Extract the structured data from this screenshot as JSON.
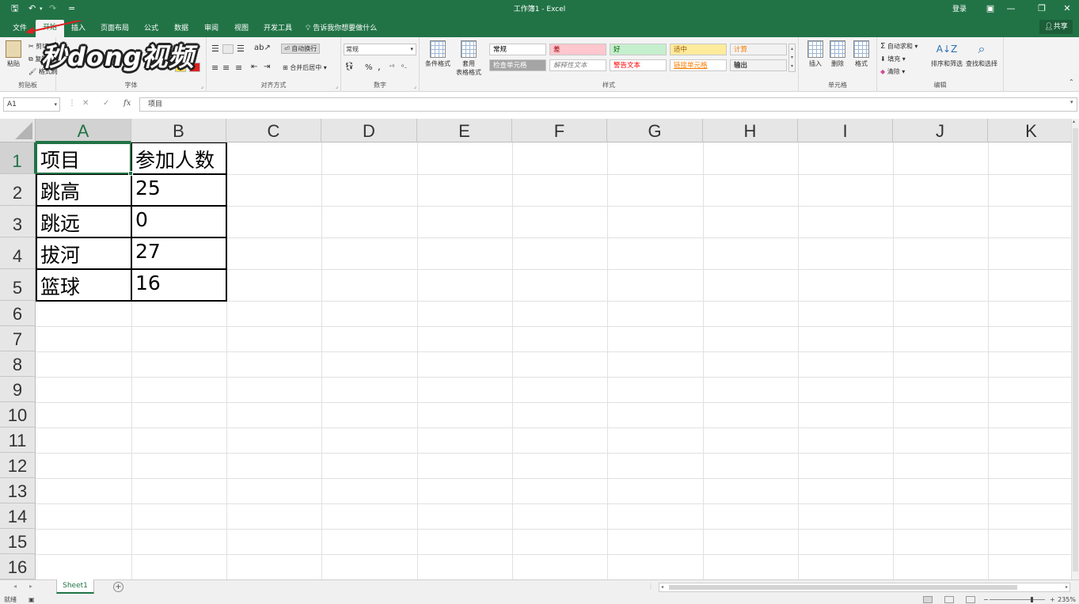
{
  "window": {
    "title": "工作簿1  -  Excel",
    "user": "登录",
    "minimize_glyph": "—",
    "restore_glyph": "❐",
    "close_glyph": "✕",
    "ribbon_toggle_glyph": "▣"
  },
  "quick_access": {
    "save_glyph": "🖫",
    "undo_glyph": "↶",
    "redo_glyph": "↷",
    "customize_glyph": "="
  },
  "tabs": {
    "file": "文件",
    "home": "开始",
    "insert": "插入",
    "page_layout": "页面布局",
    "formulas": "公式",
    "data": "数据",
    "review": "审阅",
    "view": "视图",
    "developer": "开发工具",
    "tell_me": "告诉我你想要做什么",
    "share": "共享"
  },
  "ribbon": {
    "clipboard": {
      "label": "剪贴板",
      "paste": "粘贴",
      "cut": "剪切",
      "copy": "复制",
      "format_painter": "格式刷"
    },
    "font": {
      "label": "字体"
    },
    "alignment": {
      "label": "对齐方式",
      "wrap_text": "自动换行",
      "merge_center": "合并后居中"
    },
    "number": {
      "label": "数字",
      "format": "常规",
      "percent": "%",
      "comma": ","
    },
    "styles": {
      "label": "样式",
      "conditional": "条件格式",
      "table_line1": "套用",
      "table_line2": "表格格式",
      "cells": [
        {
          "name": "常规",
          "bg": "#ffffff",
          "color": "#000000"
        },
        {
          "name": "差",
          "bg": "#ffc7ce",
          "color": "#9c0006"
        },
        {
          "name": "好",
          "bg": "#c6efce",
          "color": "#006100"
        },
        {
          "name": "适中",
          "bg": "#ffeb9c",
          "color": "#9c5700"
        },
        {
          "name": "计算",
          "bg": "#f2f2f2",
          "color": "#fa7d00"
        },
        {
          "name": "检查单元格",
          "bg": "#a5a5a5",
          "color": "#ffffff"
        },
        {
          "name": "解释性文本",
          "bg": "#ffffff",
          "color": "#7f7f7f"
        },
        {
          "name": "警告文本",
          "bg": "#ffffff",
          "color": "#ff0000"
        },
        {
          "name": "链接单元格",
          "bg": "#ffffff",
          "color": "#fa7d00"
        },
        {
          "name": "输出",
          "bg": "#f2f2f2",
          "color": "#3f3f3f"
        }
      ]
    },
    "cells_group": {
      "label": "单元格",
      "insert": "插入",
      "delete": "删除",
      "format": "格式"
    },
    "editing": {
      "label": "编辑",
      "autosum": "自动求和",
      "fill": "填充",
      "clear": "清除",
      "sort_filter": "排序和筛选",
      "find_select": "查找和选择"
    }
  },
  "watermark": "秒dong视频",
  "formula_bar": {
    "name_box": "A1",
    "content": "项目"
  },
  "grid": {
    "columns": [
      "A",
      "B",
      "C",
      "D",
      "E",
      "F",
      "G",
      "H",
      "I",
      "J",
      "K"
    ],
    "rows": [
      "1",
      "2",
      "3",
      "4",
      "5",
      "6",
      "7",
      "8",
      "9",
      "10",
      "11",
      "12",
      "13",
      "14",
      "15",
      "16"
    ],
    "selected_cell": "A1",
    "data": [
      [
        "项目",
        "参加人数"
      ],
      [
        "跳高",
        "25"
      ],
      [
        "跳远",
        "0"
      ],
      [
        "拔河",
        "27"
      ],
      [
        "篮球",
        "16"
      ]
    ]
  },
  "sheet_tabs": {
    "active": "Sheet1",
    "add": "+"
  },
  "status": {
    "ready": "就绪",
    "zoom": "235%"
  },
  "colors": {
    "excel_green": "#217346",
    "annotation_arrow": "#e02020"
  }
}
